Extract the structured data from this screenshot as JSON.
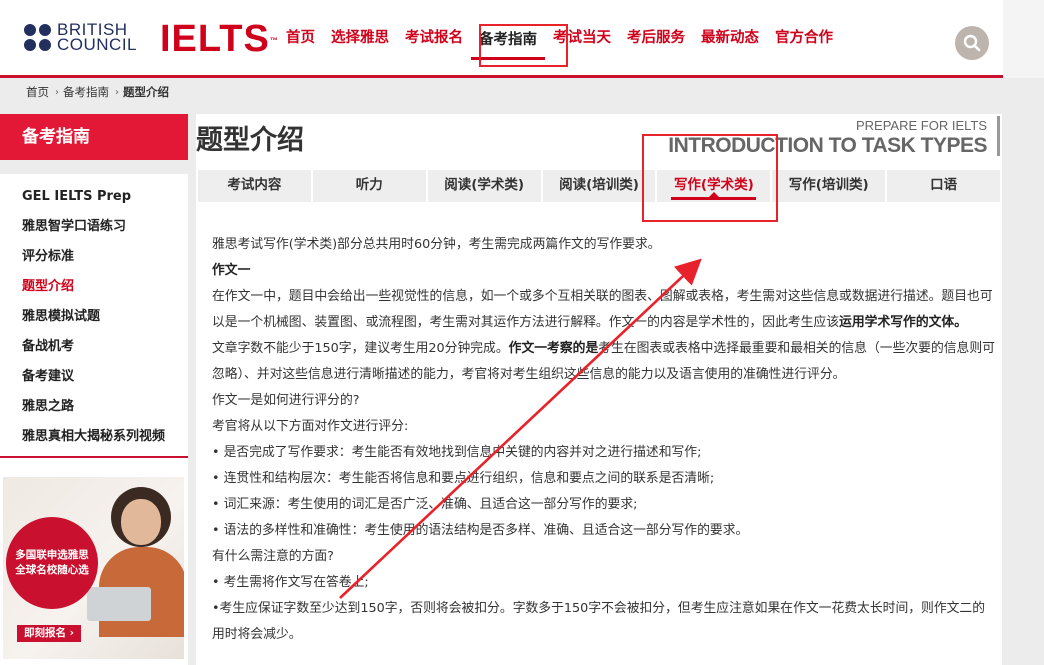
{
  "header": {
    "bc_logo_text": [
      "BRITISH",
      "COUNCIL"
    ],
    "ielts_logo": "IELTS",
    "nav": [
      {
        "label": "首页"
      },
      {
        "label": "选择雅思"
      },
      {
        "label": "考试报名"
      },
      {
        "label": "备考指南",
        "active": true
      },
      {
        "label": "考试当天"
      },
      {
        "label": "考后服务"
      },
      {
        "label": "最新动态"
      },
      {
        "label": "官方合作"
      }
    ],
    "search_icon": "search-icon"
  },
  "breadcrumb": [
    "首页",
    "备考指南",
    "题型介绍"
  ],
  "sidebar": {
    "title": "备考指南",
    "items": [
      {
        "label": "GEL IELTS Prep"
      },
      {
        "label": "雅思智学口语练习"
      },
      {
        "label": "评分标准"
      },
      {
        "label": "题型介绍",
        "active": true
      },
      {
        "label": "雅思模拟试题"
      },
      {
        "label": "备战机考"
      },
      {
        "label": "备考建议"
      },
      {
        "label": "雅思之路"
      },
      {
        "label": "雅思真相大揭秘系列视频"
      }
    ],
    "promo": {
      "line1": "多国联申选雅思",
      "line2": "全球名校随心选",
      "button": "即刻报名 ›"
    }
  },
  "main": {
    "title": "题型介绍",
    "subtitle_small": "PREPARE FOR IELTS",
    "subtitle_big": "INTRODUCTION TO TASK TYPES",
    "tabs": [
      {
        "label": "考试内容"
      },
      {
        "label": "听力"
      },
      {
        "label": "阅读(学术类)"
      },
      {
        "label": "阅读(培训类)"
      },
      {
        "label": "写作(学术类)",
        "active": true
      },
      {
        "label": "写作(培训类)"
      },
      {
        "label": "口语"
      }
    ],
    "content": {
      "intro": "雅思考试写作(学术类)部分总共用时60分钟，考生需完成两篇作文的写作要求。",
      "task1_heading": "作文一",
      "task1_p1_a": "在作文一中，题目中会给出一些视觉性的信息，如一个或多个互相关联的图表、图解或表格，考生需对这些信息或数据进行描述。题目也可以是一个机械图、装置图、或流程图，考生需对其运作方法进行解释。作文一的内容是学术性的，因此考生应该",
      "task1_p1_b": "运用学术写作的文体。",
      "task1_p2_a": "文章字数不能少于150字，建议考生用20分钟完成。",
      "task1_p2_b": "作文一考察的是",
      "task1_p2_c": "考生在图表或表格中选择最重要和最相关的信息（一些次要的信息则可忽略）、并对这些信息进行清晰描述的能力，考官将对考生组织这些信息的能力以及语言使用的准确性进行评分。",
      "eval_q": "作文一是如何进行评分的?",
      "eval_intro": "考官将从以下方面对作文进行评分:",
      "criteria": [
        "• 是否完成了写作要求：考生能否有效地找到信息中关键的内容并对之进行描述和写作;",
        "• 连贯性和结构层次：考生能否将信息和要点进行组织，信息和要点之间的联系是否清晰;",
        "• 词汇来源：考生使用的词汇是否广泛、准确、且适合这一部分写作的要求;",
        "• 语法的多样性和准确性：考生使用的语法结构是否多样、准确、且适合这一部分写作的要求。"
      ],
      "notes_q": "有什么需注意的方面?",
      "notes": [
        "• 考生需将作文写在答卷上;",
        "•考生应保证字数至少达到150字，否则将会被扣分。字数多于150字不会被扣分，但考生应注意如果在作文一花费太长时间，则作文二的用时将会减少。"
      ]
    }
  },
  "colors": {
    "brand_red": "#d0021b",
    "sidebar_red": "#e31837",
    "annotation_red": "#e8222a",
    "bc_navy": "#23305e"
  }
}
